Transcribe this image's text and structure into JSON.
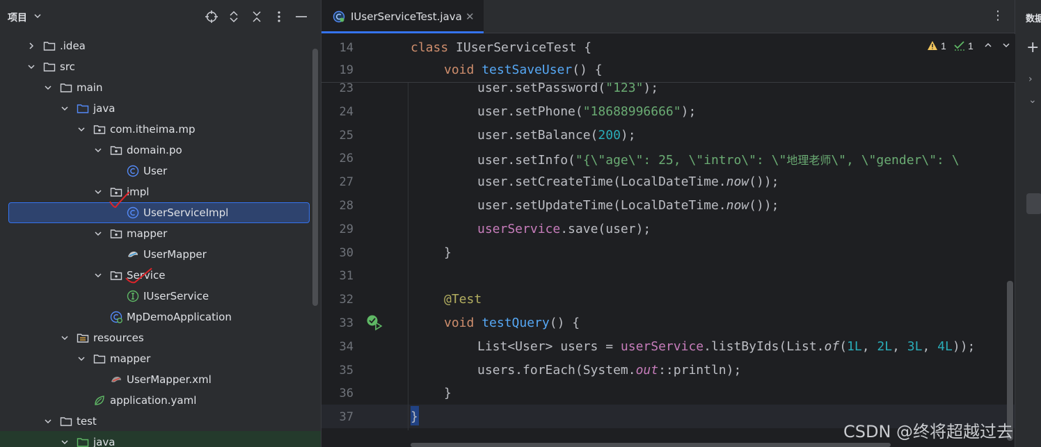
{
  "project_panel": {
    "title": "项目",
    "tree": [
      {
        "label": ".idea",
        "icon": "folder-icon",
        "expanded": false
      },
      {
        "label": "src",
        "icon": "folder-icon",
        "expanded": true
      },
      {
        "label": "main",
        "icon": "folder-icon",
        "expanded": true
      },
      {
        "label": "java",
        "icon": "source-folder-icon",
        "expanded": true
      },
      {
        "label": "com.itheima.mp",
        "icon": "package-icon",
        "expanded": true
      },
      {
        "label": "domain.po",
        "icon": "package-icon",
        "expanded": true
      },
      {
        "label": "User",
        "icon": "class-icon"
      },
      {
        "label": "impl",
        "icon": "package-icon",
        "expanded": true
      },
      {
        "label": "UserServiceImpl",
        "icon": "class-icon",
        "selected": true
      },
      {
        "label": "mapper",
        "icon": "package-icon",
        "expanded": true
      },
      {
        "label": "UserMapper",
        "icon": "mapper-icon"
      },
      {
        "label": "Service",
        "icon": "package-icon",
        "expanded": true
      },
      {
        "label": "IUserService",
        "icon": "interface-icon"
      },
      {
        "label": "MpDemoApplication",
        "icon": "spring-boot-app-icon"
      },
      {
        "label": "resources",
        "icon": "resources-folder-icon",
        "expanded": true
      },
      {
        "label": "mapper",
        "icon": "folder-icon",
        "expanded": true
      },
      {
        "label": "UserMapper.xml",
        "icon": "mybatis-xml-icon"
      },
      {
        "label": "application.yaml",
        "icon": "spring-yaml-icon"
      },
      {
        "label": "test",
        "icon": "folder-icon",
        "expanded": true
      },
      {
        "label": "java",
        "icon": "test-source-folder-icon",
        "expanded": true
      }
    ]
  },
  "editor": {
    "tab_label": "IUserServiceTest.java",
    "inspections": {
      "warnings": "1",
      "ok": "1"
    },
    "sticky": [
      {
        "ln": "14",
        "parts": [
          [
            "kw",
            "class "
          ],
          [
            "",
            "IUserServiceTest {"
          ]
        ],
        "indent": 0
      },
      {
        "ln": "19",
        "parts": [
          [
            "kw",
            "void "
          ],
          [
            "fn",
            "testSaveUser"
          ],
          [
            "",
            "() {"
          ]
        ],
        "indent": 1
      }
    ],
    "lines": [
      {
        "ln": "23",
        "indent": 2,
        "parts": [
          [
            "",
            "user.setPassword("
          ],
          [
            "str",
            "\"123\""
          ],
          [
            "",
            ");"
          ]
        ]
      },
      {
        "ln": "24",
        "indent": 2,
        "parts": [
          [
            "",
            "user.setPhone("
          ],
          [
            "str",
            "\"18688996666\""
          ],
          [
            "",
            ");"
          ]
        ]
      },
      {
        "ln": "25",
        "indent": 2,
        "parts": [
          [
            "",
            "user.setBalance("
          ],
          [
            "num",
            "200"
          ],
          [
            "",
            ");"
          ]
        ]
      },
      {
        "ln": "26",
        "indent": 2,
        "parts": [
          [
            "",
            "user.setInfo("
          ],
          [
            "str",
            "\"{\\\"age\\\": 25, \\\"intro\\\": \\\""
          ],
          [
            "str-cn",
            "地理老师"
          ],
          [
            "str",
            "\\\", \\\"gender\\\": \\"
          ]
        ]
      },
      {
        "ln": "27",
        "indent": 2,
        "parts": [
          [
            "",
            "user.setCreateTime(LocalDateTime."
          ],
          [
            "it",
            "now"
          ],
          [
            "",
            "());"
          ]
        ]
      },
      {
        "ln": "28",
        "indent": 2,
        "parts": [
          [
            "",
            "user.setUpdateTime(LocalDateTime."
          ],
          [
            "it",
            "now"
          ],
          [
            "",
            "());"
          ]
        ]
      },
      {
        "ln": "29",
        "indent": 2,
        "parts": [
          [
            "fld",
            "userService"
          ],
          [
            "",
            ".save(user);"
          ]
        ]
      },
      {
        "ln": "30",
        "indent": 1,
        "parts": [
          [
            "",
            "}"
          ]
        ]
      },
      {
        "ln": "31",
        "indent": 0,
        "parts": []
      },
      {
        "ln": "32",
        "indent": 1,
        "parts": [
          [
            "ann",
            "@Test"
          ]
        ]
      },
      {
        "ln": "33",
        "indent": 1,
        "parts": [
          [
            "kw",
            "void "
          ],
          [
            "fn",
            "testQuery"
          ],
          [
            "",
            "() {"
          ]
        ]
      },
      {
        "ln": "34",
        "indent": 2,
        "parts": [
          [
            "",
            "List<User> users = "
          ],
          [
            "fld",
            "userService"
          ],
          [
            "",
            ".listByIds(List."
          ],
          [
            "it",
            "of"
          ],
          [
            "",
            "("
          ],
          [
            "num",
            "1L"
          ],
          [
            "",
            ", "
          ],
          [
            "num",
            "2L"
          ],
          [
            "",
            ", "
          ],
          [
            "num",
            "3L"
          ],
          [
            "",
            ", "
          ],
          [
            "num",
            "4L"
          ],
          [
            "",
            "));"
          ]
        ]
      },
      {
        "ln": "35",
        "indent": 2,
        "parts": [
          [
            "",
            "users.forEach(System."
          ],
          [
            "fld-it",
            "out"
          ],
          [
            "",
            "::println);"
          ]
        ]
      },
      {
        "ln": "36",
        "indent": 1,
        "parts": [
          [
            "",
            "}"
          ]
        ]
      },
      {
        "ln": "37",
        "indent": 0,
        "parts": [
          [
            "brace",
            "}"
          ]
        ]
      }
    ]
  },
  "right_panel": {
    "title": "数据库"
  },
  "watermark": "CSDN @终将超越过去"
}
